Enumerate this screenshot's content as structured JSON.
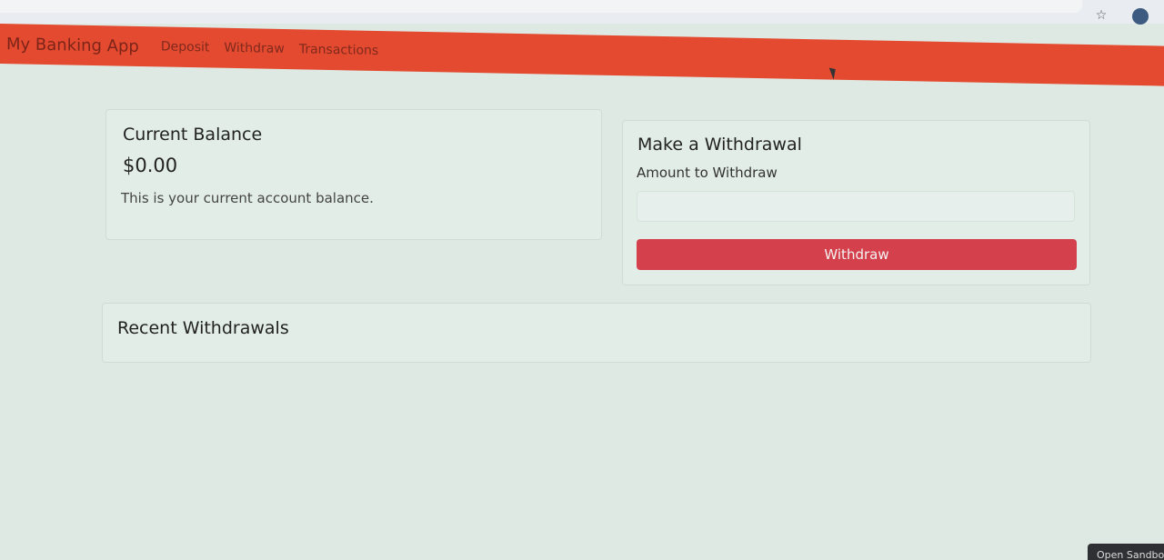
{
  "navbar": {
    "brand": "My Banking App",
    "links": [
      "Deposit",
      "Withdraw",
      "Transactions"
    ]
  },
  "balance_card": {
    "title": "Current Balance",
    "amount": "$0.00",
    "description": "This is your current account balance."
  },
  "withdraw_card": {
    "title": "Make a Withdrawal",
    "amount_label": "Amount to Withdraw",
    "amount_value": "",
    "button_label": "Withdraw"
  },
  "recent_card": {
    "title": "Recent Withdrawals"
  },
  "corner_tab": {
    "label": "Open Sandbo"
  },
  "icons": {
    "star": "star-icon",
    "profile": "profile-icon",
    "cursor": "cursor-icon"
  },
  "colors": {
    "navbar": "#e34a2f",
    "button": "#d5404d",
    "background": "#dfe9e3"
  }
}
